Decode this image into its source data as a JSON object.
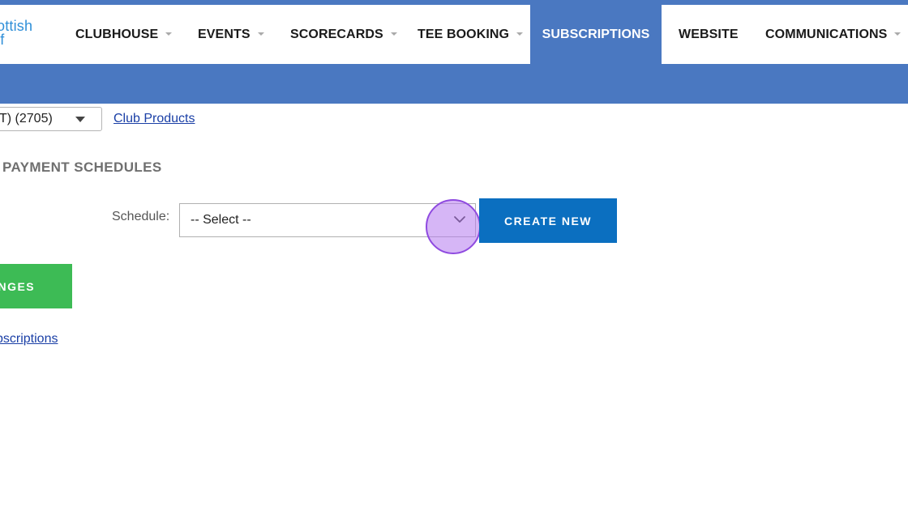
{
  "logo": {
    "line1": "ottish",
    "line2": "lf"
  },
  "nav": {
    "items": [
      {
        "label": "CLUBHOUSE",
        "has_caret": true
      },
      {
        "label": "EVENTS",
        "has_caret": true
      },
      {
        "label": "SCORECARDS",
        "has_caret": true
      },
      {
        "label": "TEE BOOKING",
        "has_caret": true
      },
      {
        "label": "SUBSCRIPTIONS",
        "active": true
      },
      {
        "label": "WEBSITE"
      },
      {
        "label": "COMMUNICATIONS",
        "has_caret": true
      }
    ]
  },
  "club_selector": {
    "value": "T) (2705)"
  },
  "club_products_link": "Club Products",
  "section": {
    "title": "PAYMENT SCHEDULES"
  },
  "schedule": {
    "label": "Schedule:",
    "selected": "-- Select --"
  },
  "buttons": {
    "create_new": "CREATE NEW",
    "save_changes": "ANGES"
  },
  "subscriptions_link": "bscriptions",
  "icons": {
    "dropdown": "chevron-down-icon",
    "club_dropdown": "triangle-down-icon",
    "nav_caret": "caret-down-icon"
  },
  "colors": {
    "brand_blue": "#4a78c1",
    "button_blue": "#0b6fc0",
    "button_green": "#3dbb55",
    "link": "#1a3fa6",
    "logo": "#2f8fd8",
    "click_highlight": "#b57aee"
  }
}
